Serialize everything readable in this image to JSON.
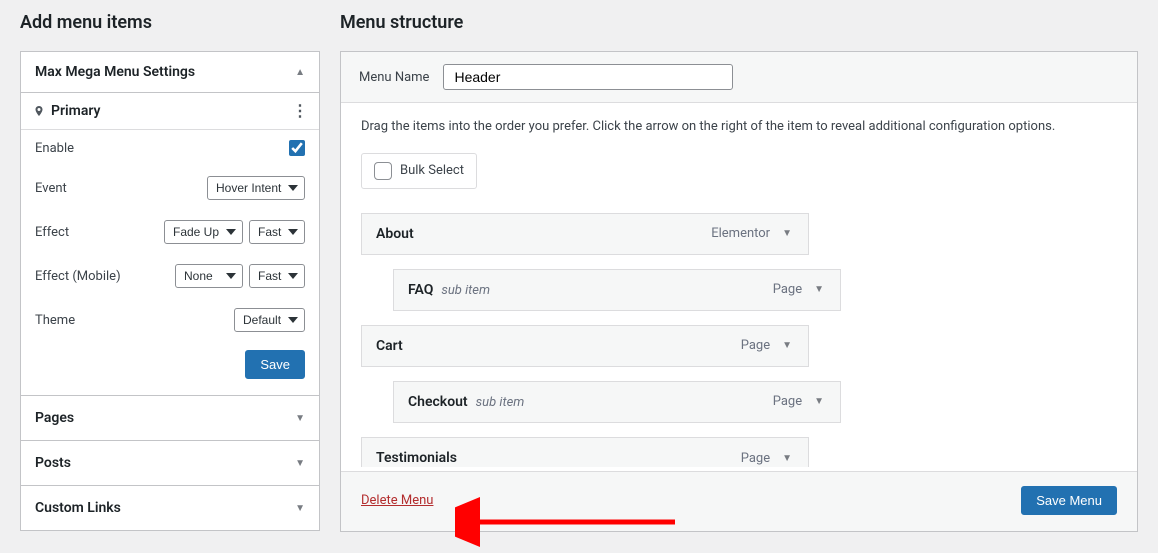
{
  "left": {
    "heading": "Add menu items",
    "settings_panel_title": "Max Mega Menu Settings",
    "primary_label": "Primary",
    "enable": {
      "label": "Enable",
      "checked": true
    },
    "event": {
      "label": "Event",
      "value": "Hover Intent"
    },
    "effect": {
      "label": "Effect",
      "values": [
        "Fade Up",
        "Fast"
      ]
    },
    "effect_mobile": {
      "label": "Effect (Mobile)",
      "values": [
        "None",
        "Fast"
      ]
    },
    "theme": {
      "label": "Theme",
      "value": "Default"
    },
    "save_label": "Save",
    "collapsibles": [
      "Pages",
      "Posts",
      "Custom Links"
    ]
  },
  "right": {
    "heading": "Menu structure",
    "menu_name_label": "Menu Name",
    "menu_name_value": "Header",
    "instructions": "Drag the items into the order you prefer. Click the arrow on the right of the item to reveal additional configuration options.",
    "bulk_select_label": "Bulk Select",
    "items": [
      {
        "title": "About",
        "sub": "",
        "type": "Elementor",
        "depth": 0
      },
      {
        "title": "FAQ",
        "sub": "sub item",
        "type": "Page",
        "depth": 1
      },
      {
        "title": "Cart",
        "sub": "",
        "type": "Page",
        "depth": 0
      },
      {
        "title": "Checkout",
        "sub": "sub item",
        "type": "Page",
        "depth": 1
      },
      {
        "title": "Testimonials",
        "sub": "",
        "type": "Page",
        "depth": 0
      }
    ],
    "delete_label": "Delete Menu",
    "save_menu_label": "Save Menu"
  }
}
